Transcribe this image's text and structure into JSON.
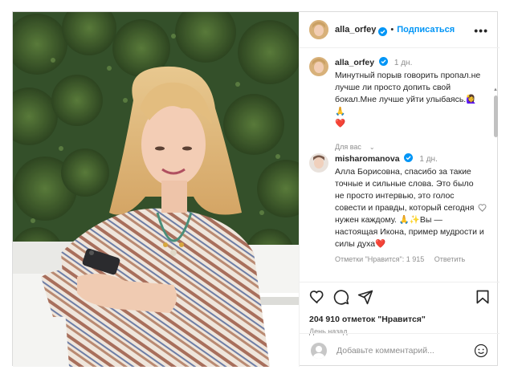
{
  "header": {
    "username": "alla_orfey",
    "verified": true,
    "follow_label": "Подписаться",
    "more_label": "•••"
  },
  "caption": {
    "username": "alla_orfey",
    "time": "1 дн.",
    "text": "Минутный порыв говорить пропал.не лучше ли просто допить свой бокал.Мне лучше уйти улыбаясь.🙋‍♀️🙏",
    "emoji_heart": "❤️",
    "translation_label": "Для вас"
  },
  "comments": [
    {
      "username": "misharomanova",
      "verified": true,
      "time": "1 дн.",
      "text": "Алла Борисовна, спасибо за такие точные и сильные слова. Это было не просто интервью, это голос совести и правды, который сегодня нужен каждому. 🙏✨Вы — настоящая Икона, пример мудрости и силы духа❤️",
      "likes_label": "Отметки \"Нравится\": 1 915",
      "reply_label": "Ответить"
    }
  ],
  "actions": {
    "like_icon": "heart-icon",
    "comment_icon": "comment-icon",
    "share_icon": "share-icon",
    "save_icon": "bookmark-icon",
    "likes_text": "204 910 отметок \"Нравится\"",
    "date_text": "День назад"
  },
  "add_comment": {
    "placeholder": "Добавьте комментарий...",
    "emoji_icon": "emoji-icon"
  },
  "colors": {
    "accent": "#0095f6",
    "heart": "#e0245e",
    "muted": "#8e8e8e"
  }
}
